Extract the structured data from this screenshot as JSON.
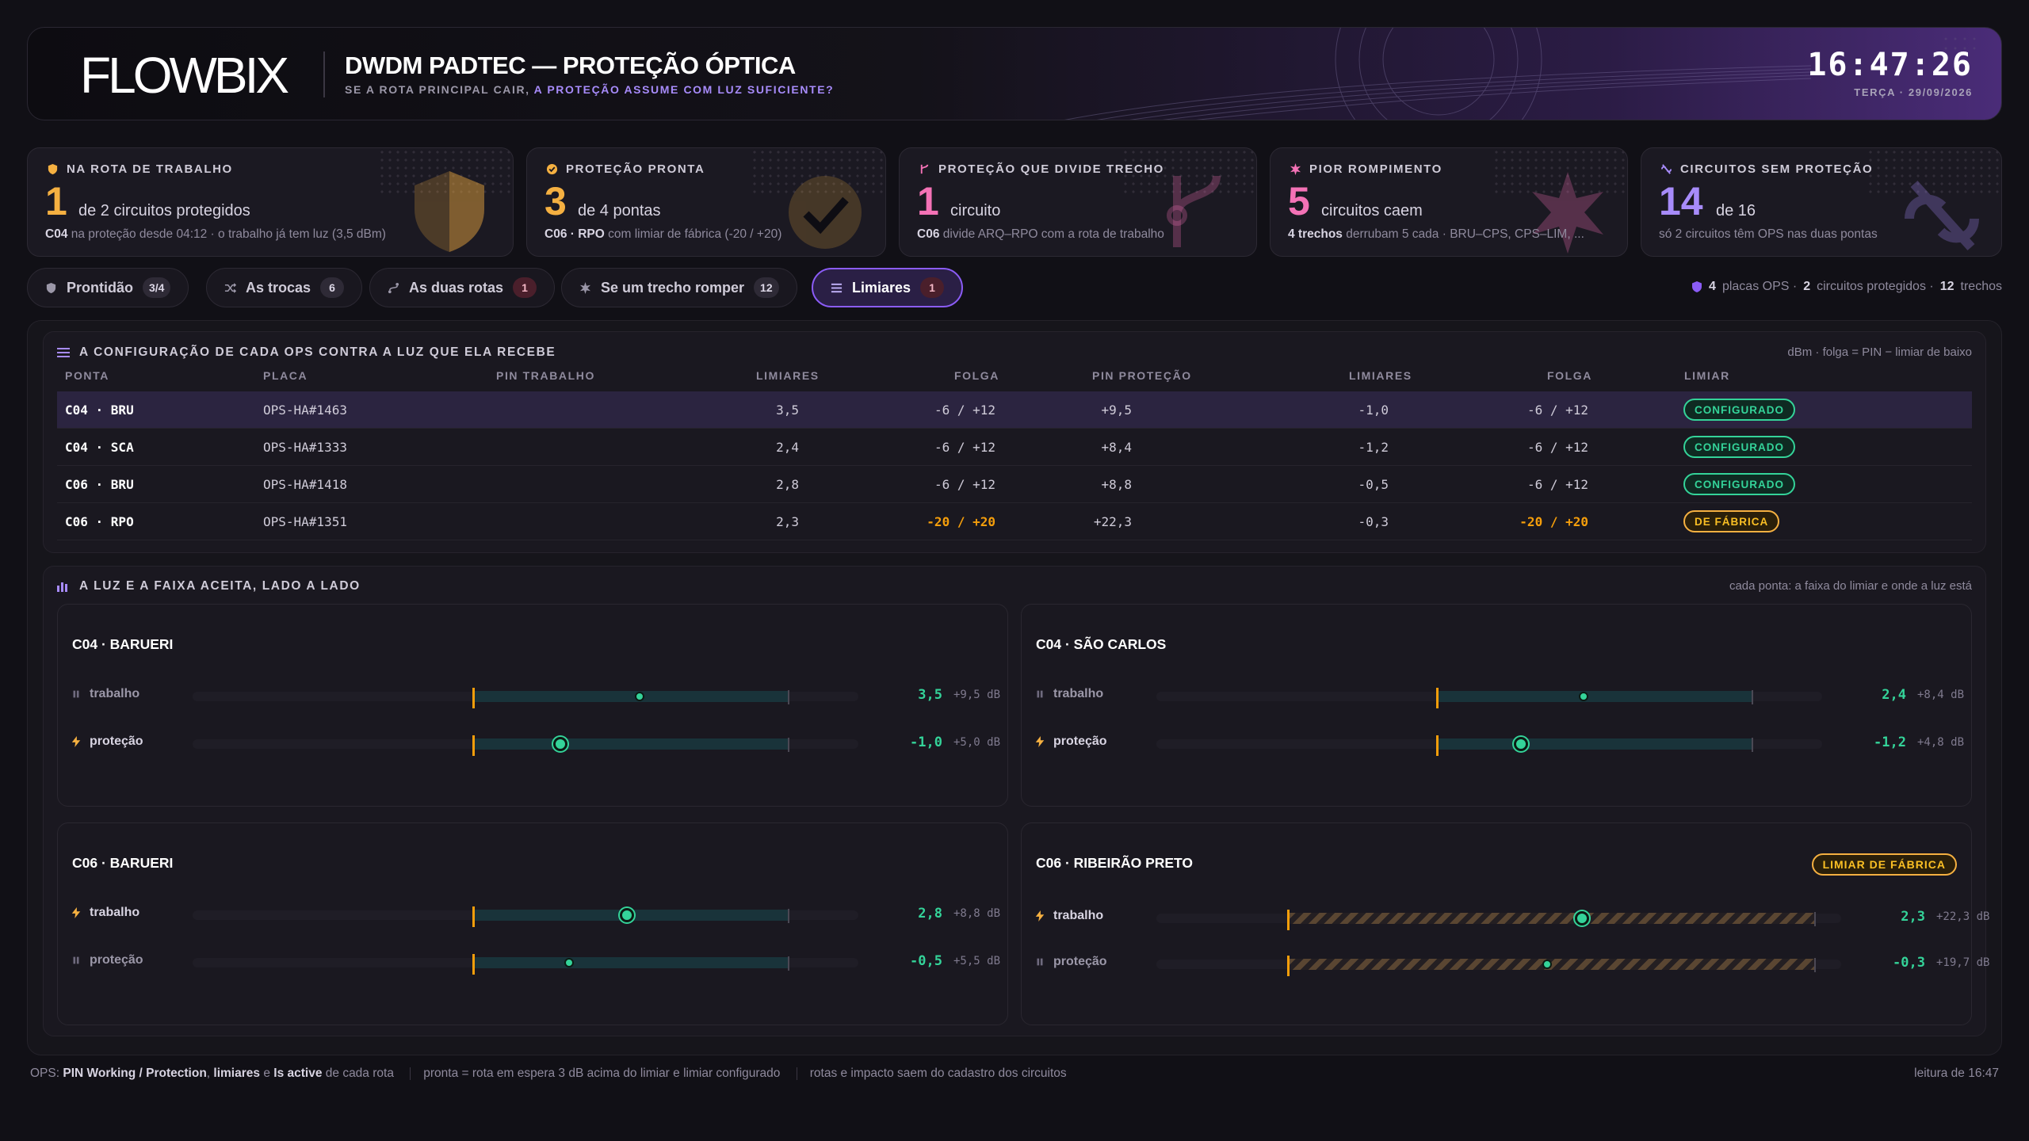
{
  "header": {
    "logo": "FLOWBIX",
    "title": "DWDM PADTEC — PROTEÇÃO ÓPTICA",
    "subtitle_a": "SE A ROTA PRINCIPAL CAIR,",
    "subtitle_b": "A PROTEÇÃO ASSUME COM LUZ SUFICIENTE?",
    "clock": "16:47:26",
    "date": "TERÇA · 29/09/2026"
  },
  "cards": [
    {
      "label": "NA ROTA DE TRABALHO",
      "value": "1",
      "text": "de 2 circuitos protegidos",
      "foot_b": "C04",
      "foot": "na proteção desde 04:12 · o trabalho já tem luz (3,5 dBm)",
      "color": "#f5b041",
      "icon": "shield-icon"
    },
    {
      "label": "PROTEÇÃO PRONTA",
      "value": "3",
      "text": "de 4 pontas",
      "foot_b": "C06 · RPO",
      "foot": "com limiar de fábrica (-20 / +20)",
      "color": "#f5b041",
      "icon": "check-circle-icon"
    },
    {
      "label": "PROTEÇÃO QUE DIVIDE TRECHO",
      "value": "1",
      "text": "circuito",
      "foot_b": "C06",
      "foot": "divide ARQ–RPO com a rota de trabalho",
      "color": "#f472b6",
      "icon": "branch-icon"
    },
    {
      "label": "PIOR ROMPIMENTO",
      "value": "5",
      "text": "circuitos caem",
      "foot_b": "4 trechos",
      "foot": "derrubam 5 cada · BRU–CPS, CPS–LIM, ...",
      "color": "#f472b6",
      "icon": "burst-icon"
    },
    {
      "label": "CIRCUITOS SEM PROTEÇÃO",
      "value": "14",
      "text": "de 16",
      "foot_b": "",
      "foot": "só 2 circuitos têm OPS nas duas pontas",
      "color": "#a78bfa",
      "icon": "broken-link-icon"
    }
  ],
  "tabs": [
    {
      "label": "Prontidão",
      "badge": "3/4",
      "icon": "shield-icon"
    },
    {
      "label": "As trocas",
      "badge": "6",
      "icon": "shuffle-icon"
    },
    {
      "label": "As duas rotas",
      "badge": "1",
      "icon": "routes-icon"
    },
    {
      "label": "Se um trecho romper",
      "badge": "12",
      "icon": "burst-icon"
    },
    {
      "label": "Limiares",
      "badge": "1",
      "icon": "sliders-icon"
    }
  ],
  "summary": {
    "a": "4",
    "a_t": "placas OPS ·",
    "b": "2",
    "b_t": "circuitos protegidos ·",
    "c": "12",
    "c_t": "trechos"
  },
  "table": {
    "title": "A CONFIGURAÇÃO DE CADA OPS CONTRA A LUZ QUE ELA RECEBE",
    "note": "dBm · folga = PIN − limiar de baixo",
    "headers": [
      "PONTA",
      "PLACA",
      "PIN TRABALHO",
      "LIMIARES",
      "FOLGA",
      "PIN PROTEÇÃO",
      "LIMIARES",
      "FOLGA",
      "LIMIAR"
    ],
    "rows": [
      {
        "ponta": "C04 · BRU",
        "placa": "OPS-HA#1463",
        "pinw": "3,5",
        "limw": "-6 / +12",
        "folw": "+9,5",
        "pinp": "-1,0",
        "limp": "-6 / +12",
        "folp": "+5,0",
        "status": "CONFIGURADO",
        "kind": "ok"
      },
      {
        "ponta": "C04 · SCA",
        "placa": "OPS-HA#1333",
        "pinw": "2,4",
        "limw": "-6 / +12",
        "folw": "+8,4",
        "pinp": "-1,2",
        "limp": "-6 / +12",
        "folp": "+4,8",
        "status": "CONFIGURADO",
        "kind": "ok"
      },
      {
        "ponta": "C06 · BRU",
        "placa": "OPS-HA#1418",
        "pinw": "2,8",
        "limw": "-6 / +12",
        "folw": "+8,8",
        "pinp": "-0,5",
        "limp": "-6 / +12",
        "folp": "+5,5",
        "status": "CONFIGURADO",
        "kind": "ok"
      },
      {
        "ponta": "C06 · RPO",
        "placa": "OPS-HA#1351",
        "pinw": "2,3",
        "limw": "-20 / +20",
        "folw": "+22,3",
        "pinp": "-0,3",
        "limp": "-20 / +20",
        "folp": "+19,7",
        "status": "DE FÁBRICA",
        "kind": "fab"
      }
    ]
  },
  "bars": {
    "title": "A LUZ E A FAIXA ACEITA, LADO A LADO",
    "note": "cada ponta: a faixa do limiar e onde a luz está",
    "panels": [
      {
        "title": "C04 · BARUERI",
        "tag": "",
        "rows": [
          {
            "label": "trabalho",
            "icon": "pause-icon",
            "active": false,
            "value": "3,5",
            "db": "+9,5 dB",
            "pin": 3.5,
            "lo": -6,
            "hi": 12
          },
          {
            "label": "proteção",
            "icon": "bolt-icon",
            "active": true,
            "value": "-1,0",
            "db": "+5,0 dB",
            "pin": -1.0,
            "lo": -6,
            "hi": 12
          }
        ]
      },
      {
        "title": "C04 · SÃO CARLOS",
        "tag": "",
        "rows": [
          {
            "label": "trabalho",
            "icon": "pause-icon",
            "active": false,
            "value": "2,4",
            "db": "+8,4 dB",
            "pin": 2.4,
            "lo": -6,
            "hi": 12
          },
          {
            "label": "proteção",
            "icon": "bolt-icon",
            "active": true,
            "value": "-1,2",
            "db": "+4,8 dB",
            "pin": -1.2,
            "lo": -6,
            "hi": 12
          }
        ]
      },
      {
        "title": "C06 · BARUERI",
        "tag": "",
        "rows": [
          {
            "label": "trabalho",
            "icon": "bolt-icon",
            "active": true,
            "value": "2,8",
            "db": "+8,8 dB",
            "pin": 2.8,
            "lo": -6,
            "hi": 12
          },
          {
            "label": "proteção",
            "icon": "pause-icon",
            "active": false,
            "value": "-0,5",
            "db": "+5,5 dB",
            "pin": -0.5,
            "lo": -6,
            "hi": 12
          }
        ]
      },
      {
        "title": "C06 · RIBEIRÃO PRETO",
        "tag": "LIMIAR DE FÁBRICA",
        "rows": [
          {
            "label": "trabalho",
            "icon": "bolt-icon",
            "active": true,
            "value": "2,3",
            "db": "+22,3 dB",
            "pin": 2.3,
            "lo": -20,
            "hi": 20
          },
          {
            "label": "proteção",
            "icon": "pause-icon",
            "active": false,
            "value": "-0,3",
            "db": "+19,7 dB",
            "pin": -0.3,
            "lo": -20,
            "hi": 20
          }
        ]
      }
    ]
  },
  "footer": {
    "a1": "OPS:",
    "a2": "PIN Working / Protection",
    "a3": ",",
    "a4": "limiares",
    "a5": "e",
    "a6": "Is active",
    "a7": "de cada rota",
    "b": "pronta = rota em espera 3 dB acima do limiar e limiar configurado",
    "c": "rotas e impacto saem do cadastro dos circuitos",
    "right": "leitura de 16:47"
  }
}
